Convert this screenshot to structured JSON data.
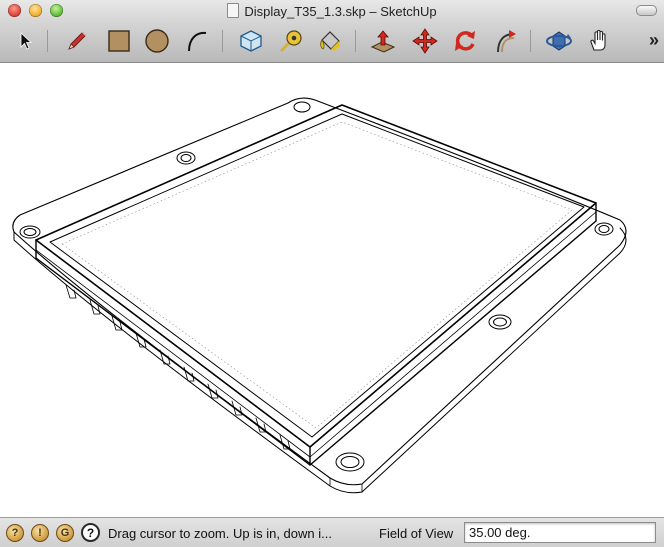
{
  "window": {
    "title": "Display_T35_1.3.skp – SketchUp"
  },
  "toolbar": {
    "tools": [
      {
        "name": "select-tool",
        "icon": "arrow-cursor-icon"
      },
      {
        "name": "line-tool",
        "icon": "pencil-icon"
      },
      {
        "name": "rectangle-tool",
        "icon": "rectangle-icon"
      },
      {
        "name": "circle-tool",
        "icon": "circle-icon"
      },
      {
        "name": "arc-tool",
        "icon": "arc-icon"
      },
      {
        "name": "make-component-tool",
        "icon": "component-box-icon"
      },
      {
        "name": "tape-measure-tool",
        "icon": "tape-measure-icon"
      },
      {
        "name": "paint-bucket-tool",
        "icon": "paint-bucket-icon"
      },
      {
        "name": "push-pull-tool",
        "icon": "push-pull-icon"
      },
      {
        "name": "move-tool",
        "icon": "move-arrows-icon"
      },
      {
        "name": "rotate-tool",
        "icon": "rotate-icon"
      },
      {
        "name": "follow-me-tool",
        "icon": "follow-me-icon"
      },
      {
        "name": "orbit-tool",
        "icon": "orbit-icon"
      },
      {
        "name": "pan-tool",
        "icon": "hand-icon"
      }
    ],
    "overflow_label": "»"
  },
  "statusbar": {
    "status_icons": [
      "geo-location-icon",
      "credits-icon",
      "google-account-icon"
    ],
    "help_label": "?",
    "message": "Drag cursor to zoom.  Up is in, down i...",
    "measurements_label": "Field of View",
    "measurements_value": "35.00 deg."
  }
}
